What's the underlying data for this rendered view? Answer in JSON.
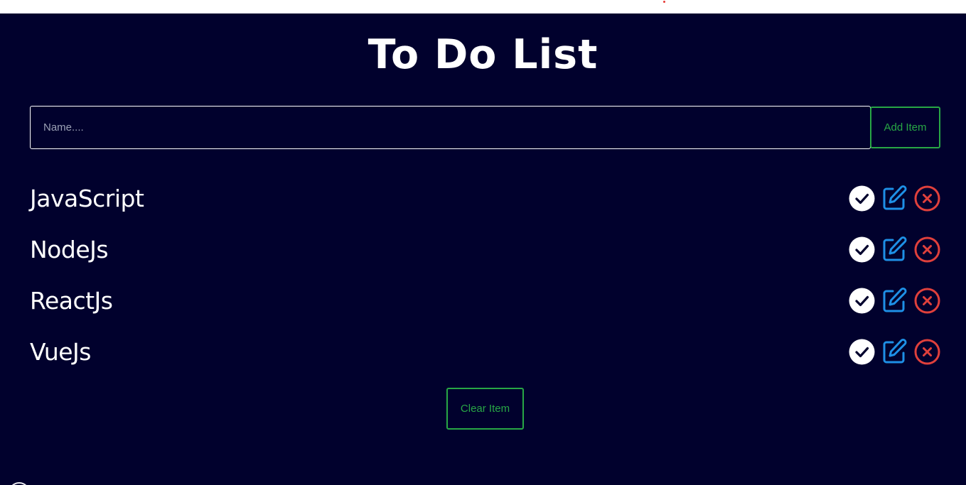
{
  "header": {
    "title": "To Do List"
  },
  "form": {
    "placeholder": "Name....",
    "value": "",
    "add_label": "Add Item"
  },
  "items": [
    {
      "text": "JavaScript"
    },
    {
      "text": "NodeJs"
    },
    {
      "text": "ReactJs"
    },
    {
      "text": "VueJs"
    }
  ],
  "actions": {
    "icons": [
      "check-circle-icon",
      "edit-icon",
      "delete-circle-icon"
    ]
  },
  "footer": {
    "clear_label": "Clear Item"
  },
  "colors": {
    "background": "#01012d",
    "accent_green": "#28a745",
    "edit_blue": "#1e90e6",
    "delete_red": "#e0403c",
    "text": "#ffffff"
  }
}
